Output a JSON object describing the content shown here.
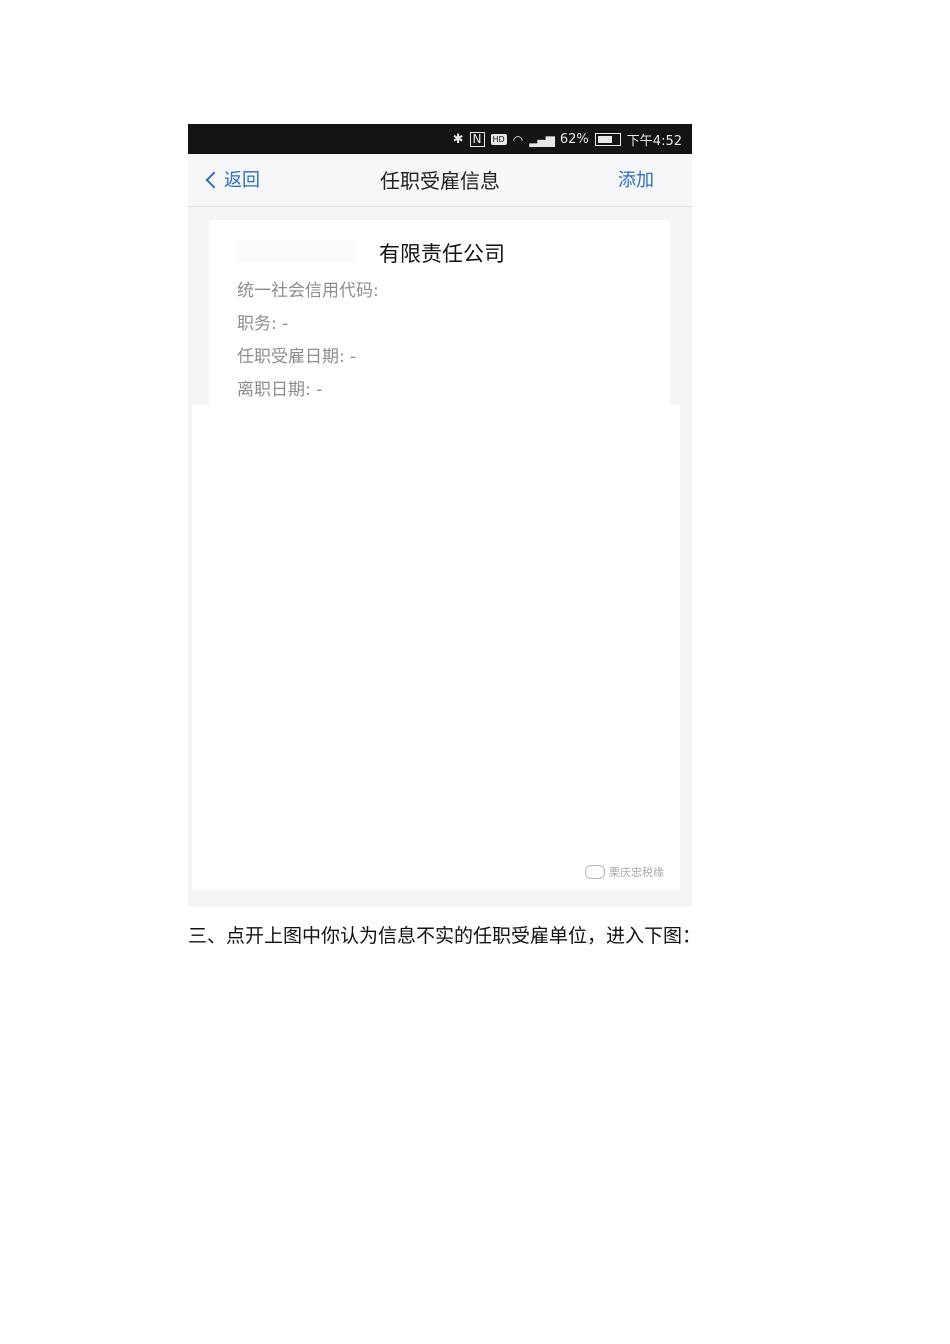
{
  "status_bar": {
    "battery": "62%",
    "time": "下午4:52",
    "icons": [
      "bluetooth-icon",
      "nfc-icon",
      "hd-icon",
      "wifi-icon",
      "signal-icon",
      "battery-icon"
    ]
  },
  "nav": {
    "back_label": "返回",
    "title": "任职受雇信息",
    "add_label": "添加"
  },
  "card": {
    "company": "有限责任公司",
    "credit_code_label": "统一社会信用代码:",
    "position_label": "职务: -",
    "hire_date_label": "任职受雇日期: -",
    "leave_date_label": "离职日期: -"
  },
  "watermark": "栗庆忠税缘",
  "caption": "三、点开上图中你认为信息不实的任职受雇单位，进入下图：",
  "colors": {
    "accent": "#2d6cc4",
    "status_bar": "#141414"
  }
}
